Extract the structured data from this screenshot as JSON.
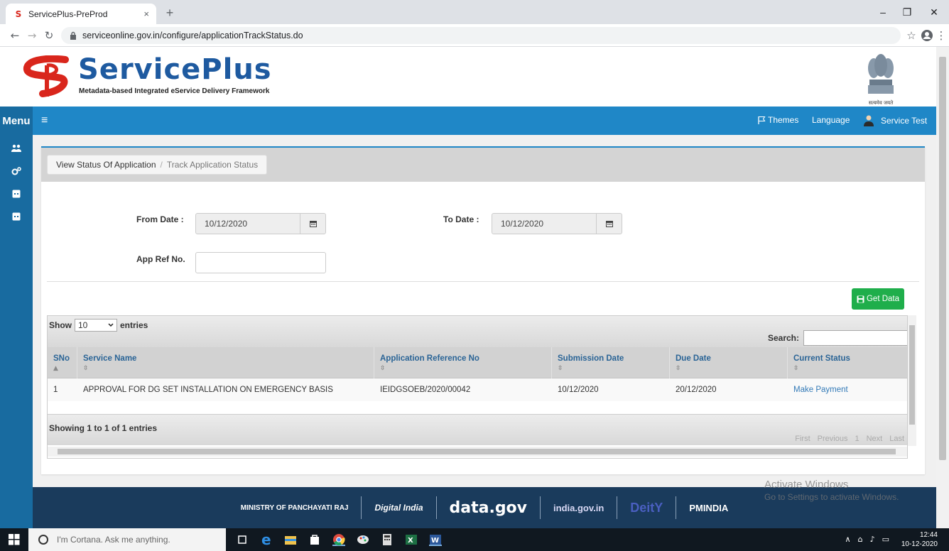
{
  "browser": {
    "tab_title": "ServicePlus-PreProd",
    "tab_close": "×",
    "new_tab": "+",
    "url": "serviceonline.gov.in/configure/applicationTrackStatus.do",
    "win_min": "–",
    "win_max": "❐",
    "win_close": "✕"
  },
  "header": {
    "brand": "ServicePlus",
    "tagline": "Metadata-based Integrated eService Delivery Framework",
    "emblem_caption": "सत्यमेव जयते"
  },
  "navbar": {
    "menu_label": "Menu",
    "themes": "Themes",
    "language": "Language",
    "user": "Service Test"
  },
  "breadcrumb": {
    "parent": "View Status Of Application",
    "separator": "/",
    "current": "Track Application Status"
  },
  "form": {
    "from_date_label": "From Date :",
    "from_date_value": "10/12/2020",
    "to_date_label": "To Date :",
    "to_date_value": "10/12/2020",
    "app_ref_label": "App Ref No.",
    "app_ref_value": "",
    "get_data": "Get Data"
  },
  "table": {
    "show_label": "Show",
    "show_value": "10",
    "entries_label": "entries",
    "search_label": "Search:",
    "columns": [
      "SNo",
      "Service Name",
      "Application Reference No",
      "Submission Date",
      "Due Date",
      "Current Status"
    ],
    "rows": [
      [
        "1",
        "APPROVAL FOR DG SET INSTALLATION ON EMERGENCY BASIS",
        "IEIDGSOEB/2020/00042",
        "10/12/2020",
        "20/12/2020",
        "Make Payment"
      ]
    ],
    "info": "Showing 1 to 1 of 1 entries",
    "pager": [
      "First",
      "Previous",
      "1",
      "Next",
      "Last"
    ]
  },
  "footer": {
    "logos": [
      "MINISTRY OF PANCHAYATI RAJ",
      "Digital India",
      "data.gov",
      "india.gov.in",
      "DeitY",
      "PMINDIA"
    ]
  },
  "watermark": {
    "line1": "Activate Windows",
    "line2": "Go to Settings to activate Windows."
  },
  "taskbar": {
    "cortana": "I'm Cortana. Ask me anything.",
    "time": "12:44",
    "date": "10-12-2020"
  },
  "colors": {
    "navbar": "#1f87c7",
    "sidebar": "#186ba0",
    "brand": "#1e5aa0",
    "get_data": "#1fae4b",
    "link": "#337ab7",
    "footer": "#1a3b5c"
  }
}
